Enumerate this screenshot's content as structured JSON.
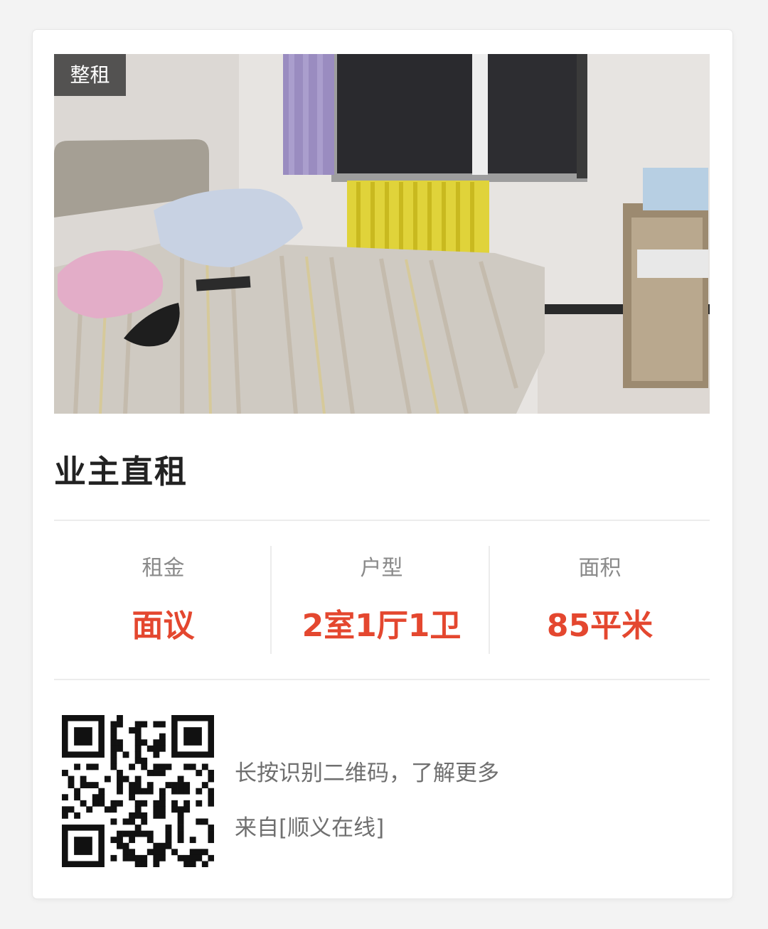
{
  "listing": {
    "tag": "整租",
    "title": "业主直租",
    "photo_alt": "卧室照片"
  },
  "stats": [
    {
      "label": "租金",
      "value": "面议"
    },
    {
      "label": "户型",
      "value": "2室1厅1卫"
    },
    {
      "label": "面积",
      "value": "85平米"
    }
  ],
  "footer": {
    "hint": "长按识别二维码，了解更多",
    "source": "来自[顺义在线]"
  },
  "colors": {
    "accent": "#e4472f",
    "title": "#222222",
    "label": "#8a8a8a",
    "muted": "#6f6f6f",
    "tag_bg": "#343434"
  }
}
